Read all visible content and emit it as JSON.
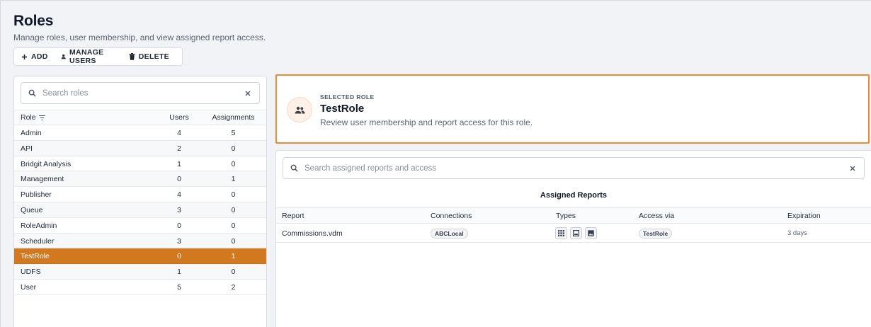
{
  "page": {
    "title": "Roles",
    "subtitle": "Manage roles, user membership, and view assigned report access."
  },
  "toolbar": {
    "add_label": "ADD",
    "manage_users_label": "MANAGE USERS",
    "delete_label": "DELETE"
  },
  "roles_panel": {
    "search_placeholder": "Search roles",
    "columns": {
      "role": "Role",
      "users": "Users",
      "assignments": "Assignments"
    },
    "rows": [
      {
        "name": "Admin",
        "users": "4",
        "assignments": "5"
      },
      {
        "name": "API",
        "users": "2",
        "assignments": "0"
      },
      {
        "name": "Bridgit Analysis",
        "users": "1",
        "assignments": "0"
      },
      {
        "name": "Management",
        "users": "0",
        "assignments": "1"
      },
      {
        "name": "Publisher",
        "users": "4",
        "assignments": "0"
      },
      {
        "name": "Queue",
        "users": "3",
        "assignments": "0"
      },
      {
        "name": "RoleAdmin",
        "users": "0",
        "assignments": "0"
      },
      {
        "name": "Scheduler",
        "users": "3",
        "assignments": "0"
      },
      {
        "name": "TestRole",
        "users": "0",
        "assignments": "1"
      },
      {
        "name": "UDFS",
        "users": "1",
        "assignments": "0"
      },
      {
        "name": "User",
        "users": "5",
        "assignments": "2"
      }
    ],
    "selected_row": "TestRole"
  },
  "selected_role": {
    "eyebrow": "SELECTED ROLE",
    "name": "TestRole",
    "description": "Review user membership and report access for this role."
  },
  "reports_panel": {
    "search_placeholder": "Search assigned reports and access",
    "section_title": "Assigned Reports",
    "columns": {
      "report": "Report",
      "connections": "Connections",
      "types": "Types",
      "access_via": "Access via",
      "expiration": "Expiration"
    },
    "rows": [
      {
        "report": "Commissions.vdm",
        "connection": "ABCLocal",
        "types": [
          "grid-icon",
          "dashboard-icon",
          "image-icon"
        ],
        "access_via": "TestRole",
        "expiration": "3 days"
      }
    ]
  },
  "colors": {
    "accent": "#d2781f",
    "highlight_border": "#ef8a2f",
    "background": "#f1f3f6"
  }
}
